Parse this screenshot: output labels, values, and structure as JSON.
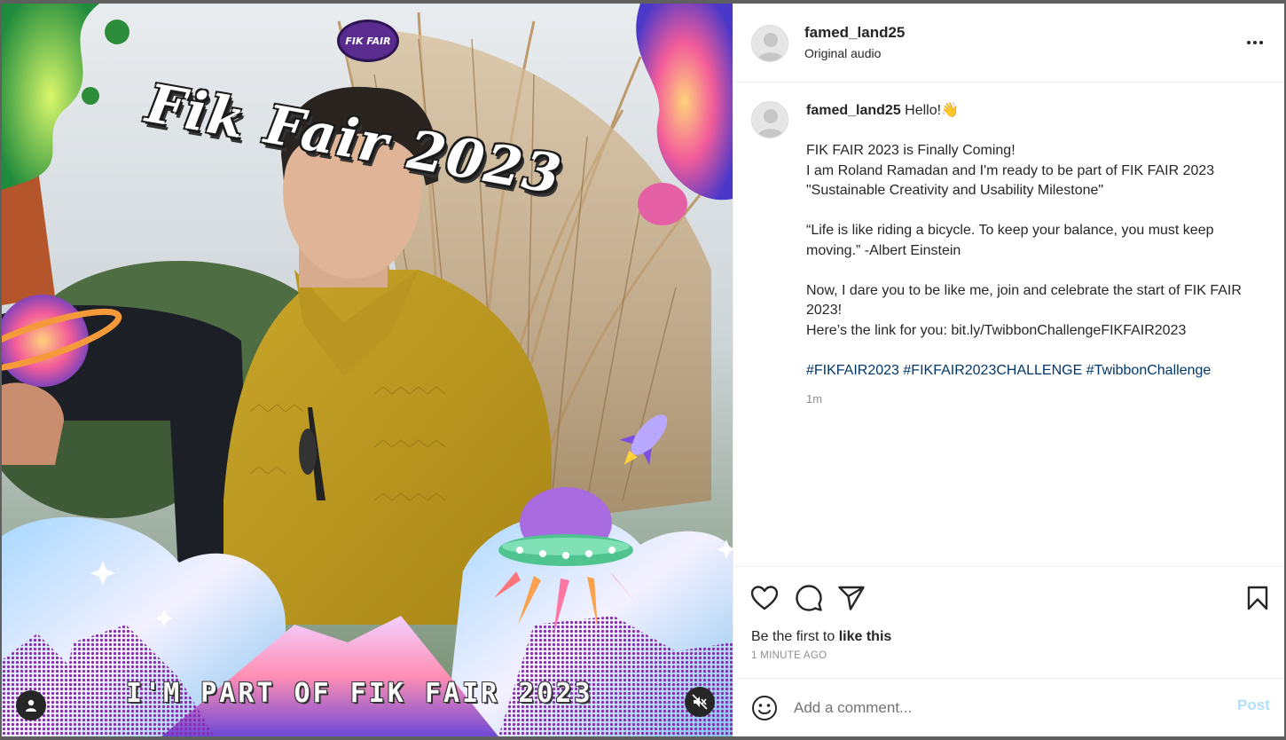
{
  "media": {
    "logo_text": "FIK FAIR",
    "title": "Fik Fair 2023",
    "overlay_caption": "I'M PART OF FIK FAIR 2023",
    "user_tag_icon": "person-icon",
    "mute_icon": "speaker-muted-icon"
  },
  "header": {
    "username": "famed_land25",
    "audio": "Original audio",
    "more_icon": "more-horizontal-icon"
  },
  "caption": {
    "username": "famed_land25",
    "greeting": "Hello!👋",
    "lines": [
      "FIK FAIR 2023 is Finally Coming!",
      "I am Roland Ramadan and I'm ready to be part of FIK FAIR 2023",
      "\"Sustainable Creativity and Usability Milestone\"",
      "“Life is like riding a bicycle. To keep your balance, you must keep moving.” -Albert Einstein",
      "Now, I dare you to be like me, join and celebrate the start of FIK FAIR 2023!",
      "Here’s the link for you: bit.ly/TwibbonChallengeFIKFAIR2023"
    ],
    "hashtags": [
      "#FIKFAIR2023",
      "#FIKFAIR2023CHALLENGE",
      "#TwibbonChallenge"
    ],
    "time": "1m"
  },
  "actions": {
    "like_icon": "heart-icon",
    "comment_icon": "comment-icon",
    "share_icon": "send-icon",
    "save_icon": "bookmark-icon"
  },
  "likes": {
    "prefix": "Be the first to ",
    "link": "like this"
  },
  "timestamp": "1 MINUTE AGO",
  "comment_box": {
    "emoji_icon": "emoji-icon",
    "placeholder": "Add a comment...",
    "post_label": "Post"
  },
  "colors": {
    "link_blue": "#00376b",
    "post_disabled": "#b2dffc",
    "secondary_text": "#8e8e8e"
  }
}
